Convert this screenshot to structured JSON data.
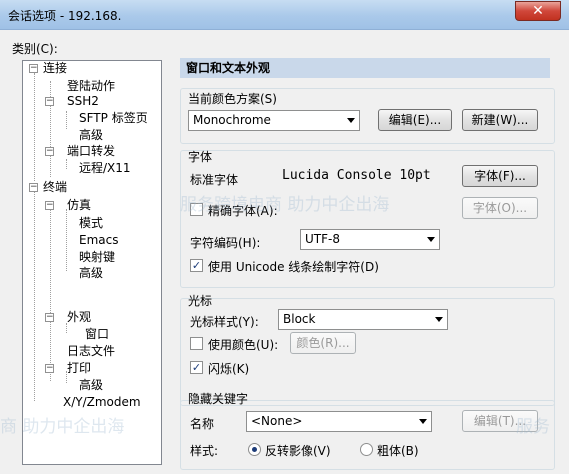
{
  "window": {
    "title": "会话选项 - 192.168.",
    "close_glyph": "✕"
  },
  "category_label": "类别(C):",
  "tree": {
    "connection": "连接",
    "login_actions": "登陆动作",
    "ssh2": "SSH2",
    "sftp_tab": "SFTP 标签页",
    "advanced1": "高级",
    "port_forwarding": "端口转发",
    "remote_x11": "远程/X11",
    "terminal": "终端",
    "emulation": "仿真",
    "modes": "模式",
    "emacs": "Emacs",
    "mapped_keys": "映射键",
    "advanced2": "高级",
    "appearance": "外观",
    "window": "窗口",
    "log_file": "日志文件",
    "printing": "打印",
    "advanced3": "高级",
    "xymodem": "X/Y/Zmodem"
  },
  "panel": {
    "header": "窗口和文本外观",
    "color_scheme_label": "当前颜色方案(S)",
    "color_scheme_value": "Monochrome",
    "edit_button": "编辑(E)...",
    "new_button": "新建(W)...",
    "font_section": "字体",
    "normal_font_label": "标准字体",
    "normal_font_value": "Lucida Console 10pt",
    "font_button": "字体(F)...",
    "precise_font_label": "精确字体(A):",
    "font_button2": "字体(O)...",
    "encoding_label": "字符编码(H):",
    "encoding_value": "UTF-8",
    "unicode_line_label": "使用 Unicode 线条绘制字符(D)",
    "cursor_section": "光标",
    "cursor_style_label": "光标样式(Y):",
    "cursor_style_value": "Block",
    "use_color_label": "使用颜色(U):",
    "color_button": "颜色(R)...",
    "blink_label": "闪烁(K)",
    "hotkey_section": "隐藏关键字",
    "name_label": "名称",
    "name_value": "<None>",
    "edit_button2": "编辑(T)...",
    "style_label": "样式:",
    "reverse_video_label": "反转影像(V)",
    "bold_label": "粗体(B)"
  },
  "watermark": {
    "text1": "服务跨境电商 助力中企出海",
    "text2": "商 助力中企出海",
    "text3": "服务"
  },
  "colors": {
    "header_bg": "#c9d8ea",
    "check_mark": "#1c3b78"
  }
}
